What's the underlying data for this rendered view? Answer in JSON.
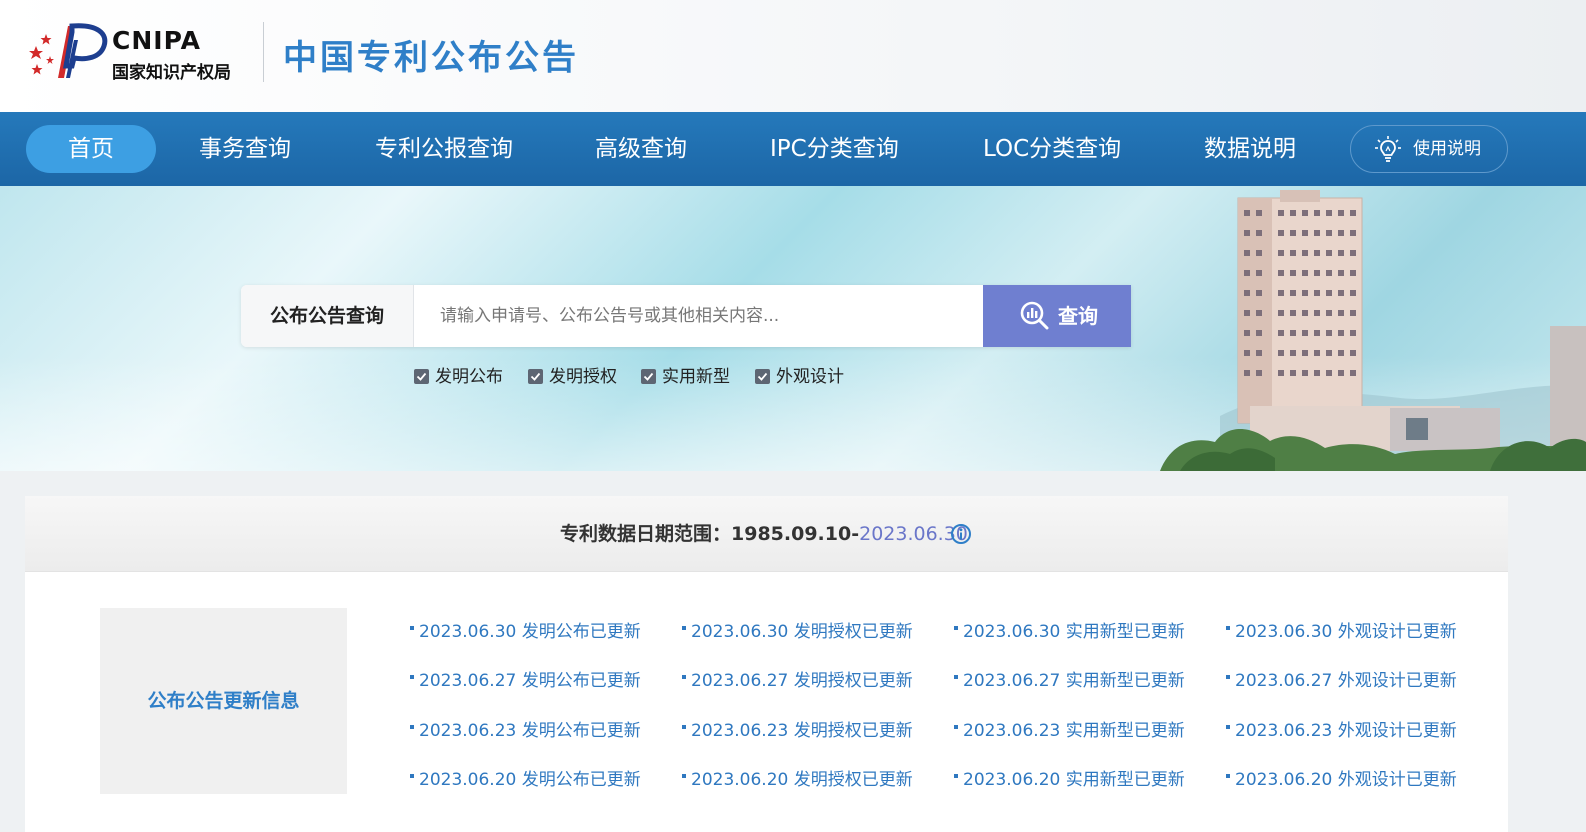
{
  "header": {
    "logo_en": "CNIPA",
    "logo_cn": "国家知识产权局",
    "site_title": "中国专利公布公告"
  },
  "nav": {
    "items": [
      {
        "label": "首页",
        "active": true
      },
      {
        "label": "事务查询"
      },
      {
        "label": "专利公报查询"
      },
      {
        "label": "高级查询"
      },
      {
        "label": "IPC分类查询"
      },
      {
        "label": "LOC分类查询"
      },
      {
        "label": "数据说明"
      }
    ],
    "help_label": "使用说明",
    "help_icon": "lightbulb-icon"
  },
  "search": {
    "label": "公布公告查询",
    "placeholder": "请输入申请号、公布公告号或其他相关内容...",
    "button_label": "查询",
    "button_icon": "search-chart-icon",
    "filters": [
      {
        "label": "发明公布",
        "checked": true
      },
      {
        "label": "发明授权",
        "checked": true
      },
      {
        "label": "实用新型",
        "checked": true
      },
      {
        "label": "外观设计",
        "checked": true
      }
    ]
  },
  "range": {
    "prefix": "专利数据日期范围：",
    "start": "1985.09.10-",
    "end": "2023.06.30"
  },
  "updates": {
    "title": "公布公告更新信息",
    "rows": [
      [
        "2023.06.30 发明公布已更新",
        "2023.06.30 发明授权已更新",
        "2023.06.30 实用新型已更新",
        "2023.06.30 外观设计已更新"
      ],
      [
        "2023.06.27 发明公布已更新",
        "2023.06.27 发明授权已更新",
        "2023.06.27 实用新型已更新",
        "2023.06.27 外观设计已更新"
      ],
      [
        "2023.06.23 发明公布已更新",
        "2023.06.23 发明授权已更新",
        "2023.06.23 实用新型已更新",
        "2023.06.23 外观设计已更新"
      ],
      [
        "2023.06.20 发明公布已更新",
        "2023.06.20 发明授权已更新",
        "2023.06.20 实用新型已更新",
        "2023.06.20 外观设计已更新"
      ]
    ]
  },
  "colors": {
    "nav_bg": "#1f6fb0",
    "nav_active": "#3d9fe3",
    "accent_blue": "#2f7fc8",
    "search_button": "#6f7fd0"
  }
}
